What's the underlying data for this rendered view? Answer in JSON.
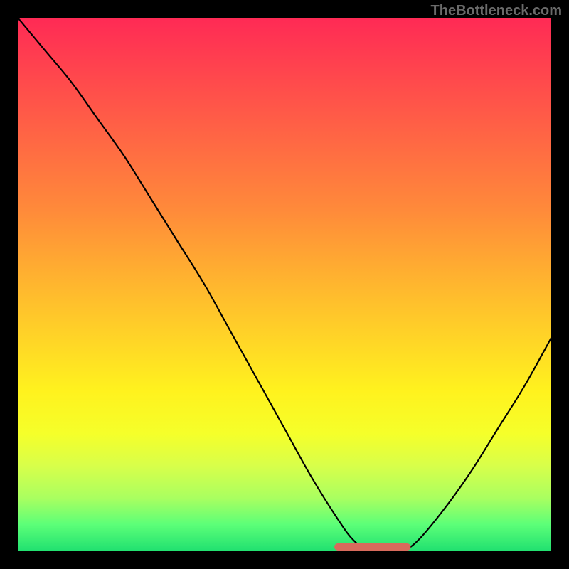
{
  "watermark": "TheBottleneck.com",
  "chart_data": {
    "type": "line",
    "title": "",
    "xlabel": "",
    "ylabel": "",
    "xlim": [
      0,
      100
    ],
    "ylim": [
      0,
      100
    ],
    "grid": false,
    "series": [
      {
        "name": "bottleneck-curve",
        "x": [
          0,
          5,
          10,
          15,
          20,
          25,
          30,
          35,
          40,
          45,
          50,
          55,
          60,
          63,
          66,
          70,
          72,
          75,
          80,
          85,
          90,
          95,
          100
        ],
        "values": [
          100,
          94,
          88,
          81,
          74,
          66,
          58,
          50,
          41,
          32,
          23,
          14,
          6,
          2,
          0,
          0,
          0,
          2,
          8,
          15,
          23,
          31,
          40
        ]
      }
    ],
    "highlight": {
      "x_range": [
        60,
        73
      ],
      "meaning": "optimal-range"
    },
    "colors": {
      "gradient_top": "#ff2a55",
      "gradient_bottom": "#20e070",
      "curve": "#000000",
      "marker": "#d86a5c",
      "background": "#000000"
    }
  }
}
